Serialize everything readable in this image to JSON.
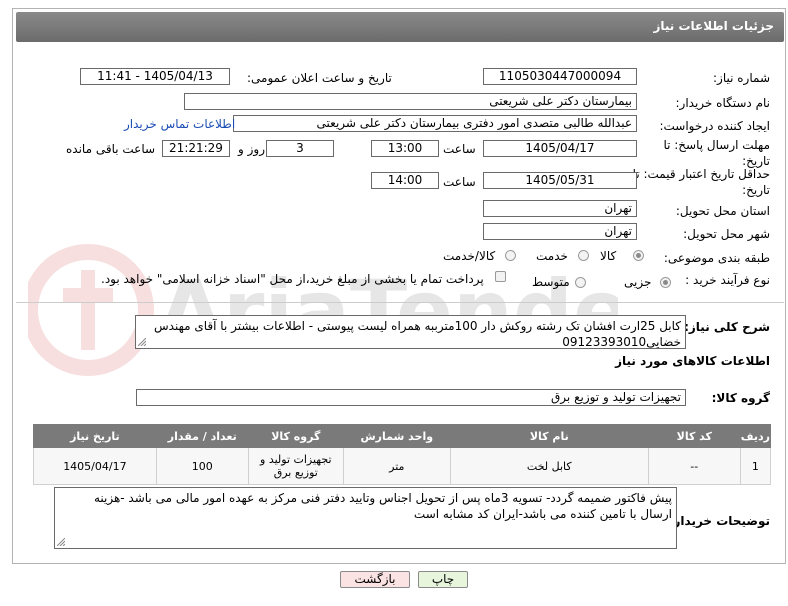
{
  "header": {
    "title": "جزئیات اطلاعات نیاز"
  },
  "form": {
    "need_number_label": "شماره نیاز:",
    "need_number": "1105030447000094",
    "announce_label": "تاریخ و ساعت اعلان عمومی:",
    "announce_value": "1405/04/13 - 11:41",
    "buyer_org_label": "نام دستگاه خریدار:",
    "buyer_org": "بیمارستان دکتر علی شریعتی",
    "requester_label": "ایجاد کننده درخواست:",
    "requester": "عبدالله طالبی متصدی امور دفتری بیمارستان دکتر علی شریعتی",
    "contact_link": "اطلاعات تماس خریدار",
    "reply_deadline_label": "مهلت ارسال پاسخ: تا تاریخ:",
    "reply_date": "1405/04/17",
    "time_label": "ساعت",
    "reply_time": "13:00",
    "days": "3",
    "days_label": "روز و",
    "remaining_time": "21:21:29",
    "remaining_label": "ساعت باقی مانده",
    "price_deadline_label": "حداقل تاریخ اعتبار قیمت: تا تاریخ:",
    "price_date": "1405/05/31",
    "price_time": "14:00",
    "delivery_province_label": "استان محل تحویل:",
    "delivery_province": "تهران",
    "delivery_city_label": "شهر محل تحویل:",
    "delivery_city": "تهران",
    "category_label": "طبقه بندی موضوعی:",
    "category_options": [
      "کالا",
      "خدمت",
      "کالا/خدمت"
    ],
    "process_label": "نوع فرآیند خرید :",
    "process_options": [
      "جزیی",
      "متوسط"
    ],
    "payment_note": "پرداخت تمام یا بخشی از مبلغ خرید،از محل \"اسناد خزانه اسلامی\" خواهد بود.",
    "general_desc_label": "شرح کلی نیاز:",
    "general_desc": "کابل 25ارت افشان تک رشته روکش دار 100مترببه همراه لیست پیوستی - اطلاعات بیشتر با آقای مهندس خضایی09123393010",
    "goods_info_title": "اطلاعات کالاهای مورد نیاز",
    "goods_group_label": "گروه کالا:",
    "goods_group": "تجهیزات تولید و توزیع برق",
    "buyer_notes_label": "توضیحات خریدار:",
    "buyer_notes": "پیش فاکتور ضمیمه گردد- تسویه 3ماه پس از تحویل اجناس وتایید دفتر فنی مرکز به عهده امور مالی می باشد -هزینه ارسال با تامین کننده می باشد-ایران کد مشابه است"
  },
  "table": {
    "headers": [
      "ردیف",
      "کد کالا",
      "نام کالا",
      "واحد شمارش",
      "گروه کالا",
      "تعداد / مقدار",
      "تاریخ نیاز"
    ],
    "rows": [
      [
        "1",
        "--",
        "کابل لخت",
        "متر",
        "تجهیزات تولید و توزیع برق",
        "100",
        "1405/04/17"
      ]
    ]
  },
  "buttons": {
    "print": "چاپ",
    "back": "بازگشت"
  },
  "colors": {
    "header_bg": "#7a7a7a",
    "print_bg": "#e6f5dc",
    "back_bg": "#fbe3e3",
    "link": "#1a4db3"
  }
}
